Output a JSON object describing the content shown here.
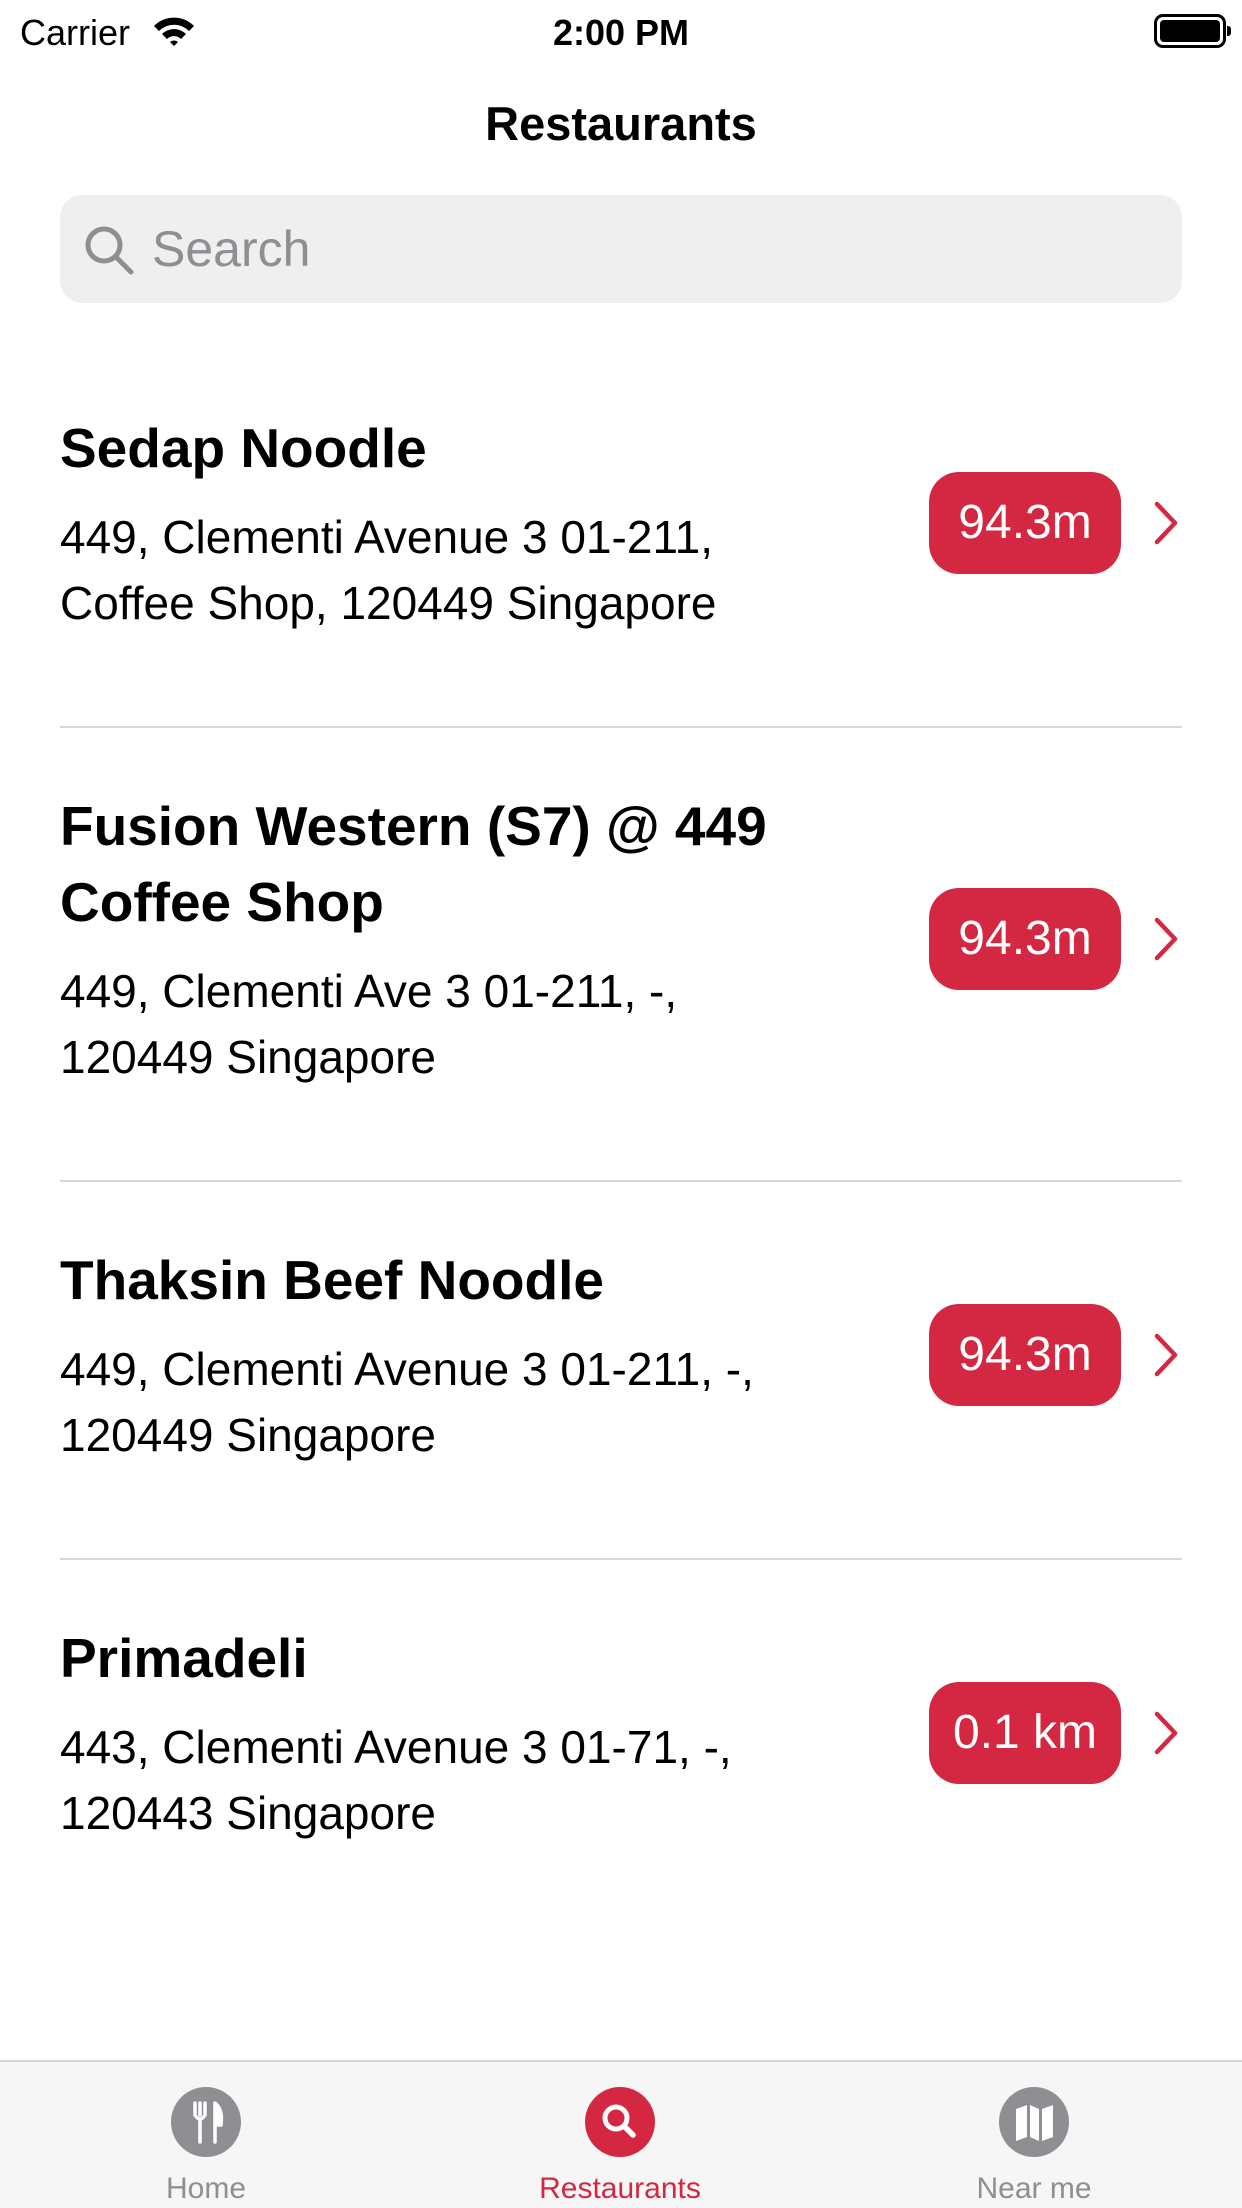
{
  "status_bar": {
    "carrier": "Carrier",
    "time": "2:00 PM"
  },
  "nav": {
    "title": "Restaurants"
  },
  "search": {
    "placeholder": "Search",
    "value": ""
  },
  "restaurants": [
    {
      "name": "Sedap Noodle",
      "address": "449, Clementi Avenue 3 01-211,\nCoffee Shop, 120449 Singapore",
      "distance": "94.3m"
    },
    {
      "name": "Fusion Western (S7) @ 449\nCoffee Shop",
      "address": "449, Clementi Ave 3 01-211, -,\n120449 Singapore",
      "distance": "94.3m"
    },
    {
      "name": "Thaksin Beef Noodle",
      "address": "449, Clementi Avenue 3 01-211, -,\n120449 Singapore",
      "distance": "94.3m"
    },
    {
      "name": "Primadeli",
      "address": "443, Clementi Avenue 3 01-71, -,\n120443 Singapore",
      "distance": "0.1 km"
    }
  ],
  "tab_bar": {
    "tabs": [
      {
        "label": "Home",
        "icon": "fork-knife-icon",
        "active": false
      },
      {
        "label": "Restaurants",
        "icon": "search-icon",
        "active": true
      },
      {
        "label": "Near me",
        "icon": "map-icon",
        "active": false
      }
    ]
  },
  "colors": {
    "accent": "#d42741",
    "inactive": "#8e8e93",
    "search_bg": "#efeff0"
  }
}
